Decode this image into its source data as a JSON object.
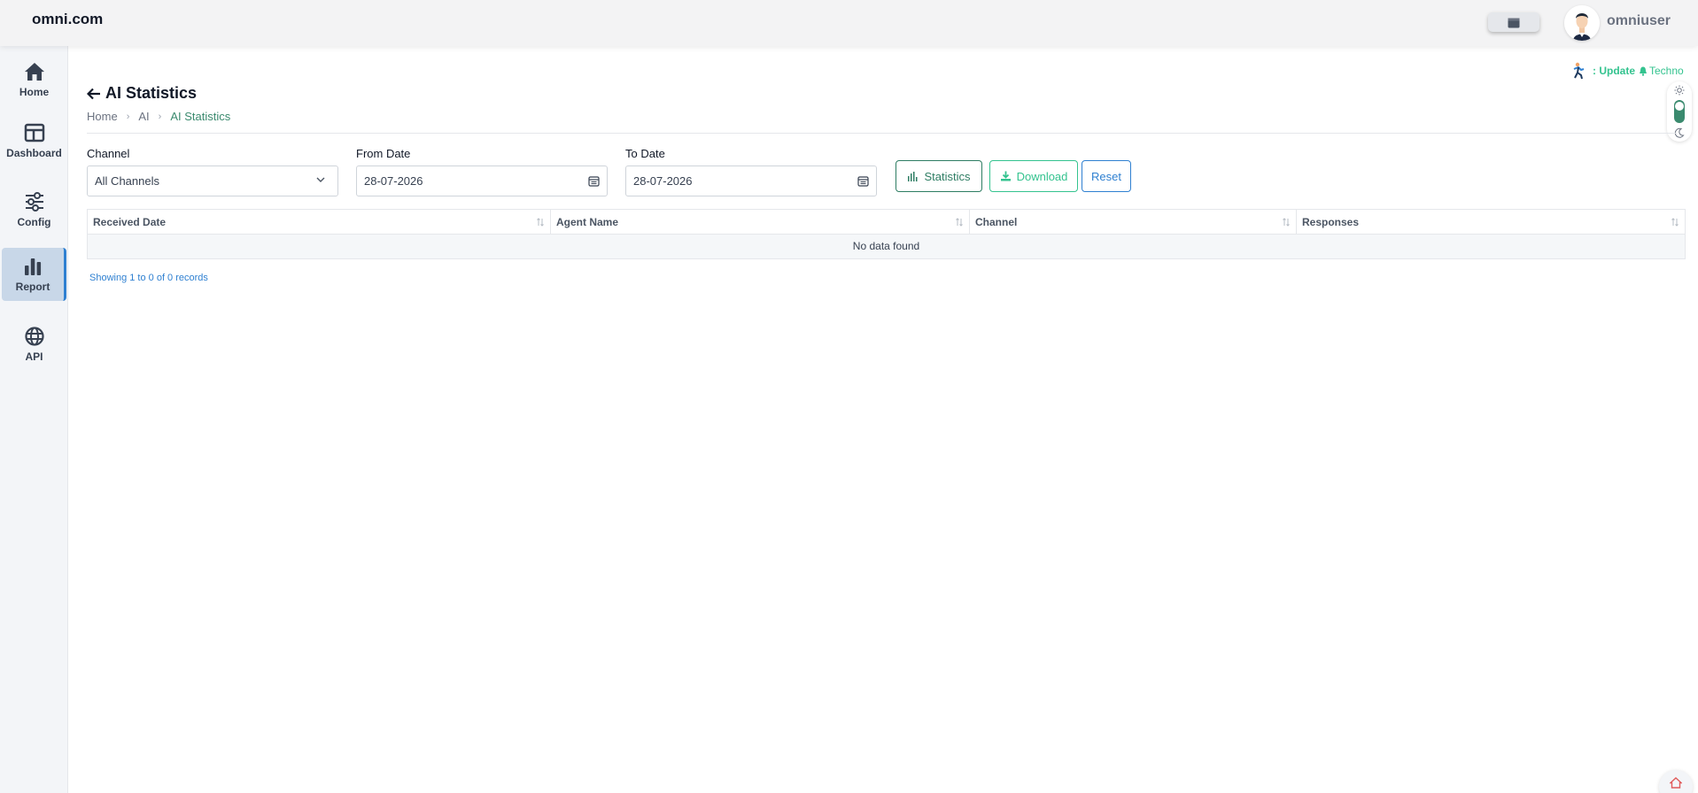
{
  "header": {
    "brand": "omni.com",
    "username": "omniuser"
  },
  "sidebar": {
    "items": [
      {
        "label": "Home",
        "icon": "home-icon"
      },
      {
        "label": "Dashboard",
        "icon": "dashboard-icon"
      },
      {
        "label": "Config",
        "icon": "sliders-icon"
      },
      {
        "label": "Report",
        "icon": "bar-chart-icon",
        "active": true
      },
      {
        "label": "API",
        "icon": "globe-icon"
      }
    ]
  },
  "page": {
    "title": "AI Statistics",
    "breadcrumb": [
      "Home",
      "AI",
      "AI Statistics"
    ]
  },
  "update_bar": {
    "prefix": ": Update",
    "suffix": "Techno"
  },
  "filters": {
    "channel_label": "Channel",
    "channel_value": "All Channels",
    "from_label": "From Date",
    "from_value": "28-07-2026",
    "to_label": "To Date",
    "to_value": "28-07-2026"
  },
  "buttons": {
    "statistics": "Statistics",
    "download": "Download",
    "reset": "Reset"
  },
  "table": {
    "columns": [
      "Received Date",
      "Agent Name",
      "Channel",
      "Responses"
    ],
    "empty_text": "No data found",
    "records_text": "Showing 1 to 0 of 0 records"
  },
  "colors": {
    "accent_green": "#2e7d63",
    "download_green": "#34c38f",
    "reset_blue": "#2f80d1",
    "sidebar_active": "#c8d7e8"
  }
}
